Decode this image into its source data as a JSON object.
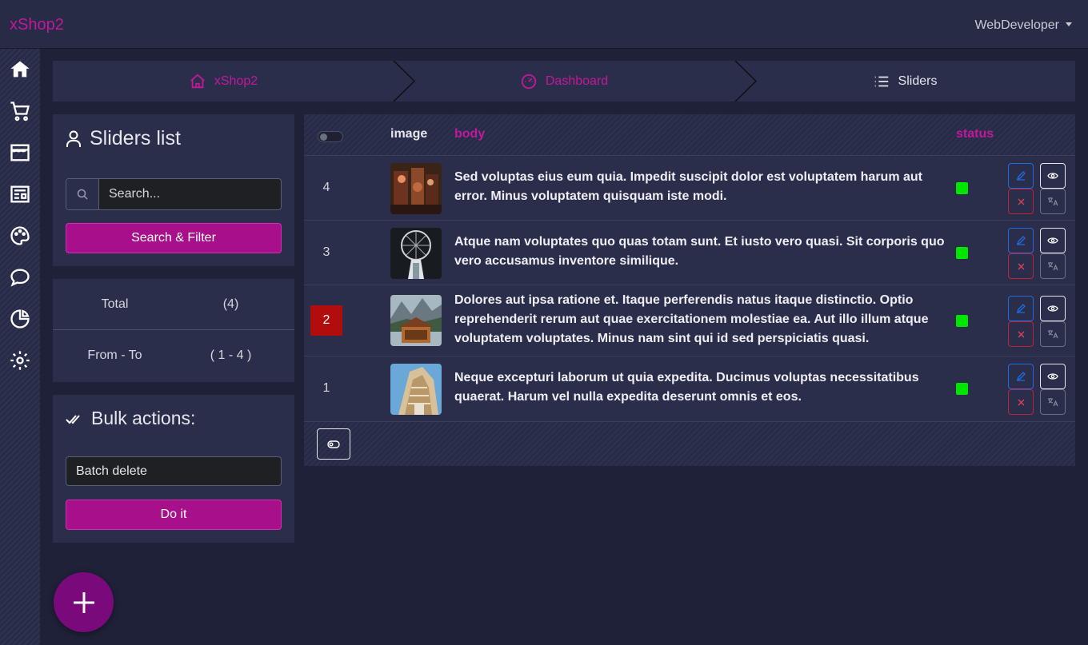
{
  "app": {
    "brand": "xShop2",
    "user": "WebDeveloper"
  },
  "sidebar": {
    "items": [
      {
        "icon": "home-icon"
      },
      {
        "icon": "cart-icon"
      },
      {
        "icon": "store-icon"
      },
      {
        "icon": "news-icon"
      },
      {
        "icon": "palette-icon"
      },
      {
        "icon": "chat-icon"
      },
      {
        "icon": "pie-chart-icon"
      },
      {
        "icon": "gear-icon"
      }
    ]
  },
  "breadcrumb": {
    "items": [
      {
        "label": "xShop2",
        "icon": "home-icon"
      },
      {
        "label": "Dashboard",
        "icon": "gauge-icon"
      },
      {
        "label": "Sliders",
        "icon": "list-icon"
      }
    ]
  },
  "list_panel": {
    "title": "Sliders list",
    "search_placeholder": "Search...",
    "search_button": "Search & Filter"
  },
  "stats": {
    "total_label": "Total",
    "total_value": "(4)",
    "range_label": "From - To",
    "range_value": "( 1 - 4 )"
  },
  "bulk": {
    "title": "Bulk actions:",
    "selected_option": "Batch delete",
    "button": "Do it"
  },
  "table": {
    "headers": {
      "image": "image",
      "body": "body",
      "status": "status"
    },
    "rows": [
      {
        "id": "4",
        "body": "Sed voluptas eius eum quia. Impedit suscipit dolor est voluptatem harum aut error. Minus voluptatem quisquam iste modi.",
        "selected": false
      },
      {
        "id": "3",
        "body": "Atque nam voluptates quo quas totam sunt. Et iusto vero quasi. Sit corporis quo vero accusamus inventore similique.",
        "selected": false
      },
      {
        "id": "2",
        "body": "Dolores aut ipsa ratione et. Itaque perferendis natus itaque distinctio. Optio reprehenderit rerum aut quae exercitationem molestiae ea. Aut illo illum atque voluptatem voluptates. Minus nam sint qui id sed perspiciatis quasi.",
        "selected": true
      },
      {
        "id": "1",
        "body": "Neque excepturi laborum ut quia expedita. Ducimus voluptas necessitatibus quaerat. Harum vel nulla expedita deserunt omnis et eos.",
        "selected": false
      }
    ]
  },
  "colors": {
    "accent": "#c2189c",
    "status_active": "#00e600",
    "selected_row": "#b10d0d"
  }
}
